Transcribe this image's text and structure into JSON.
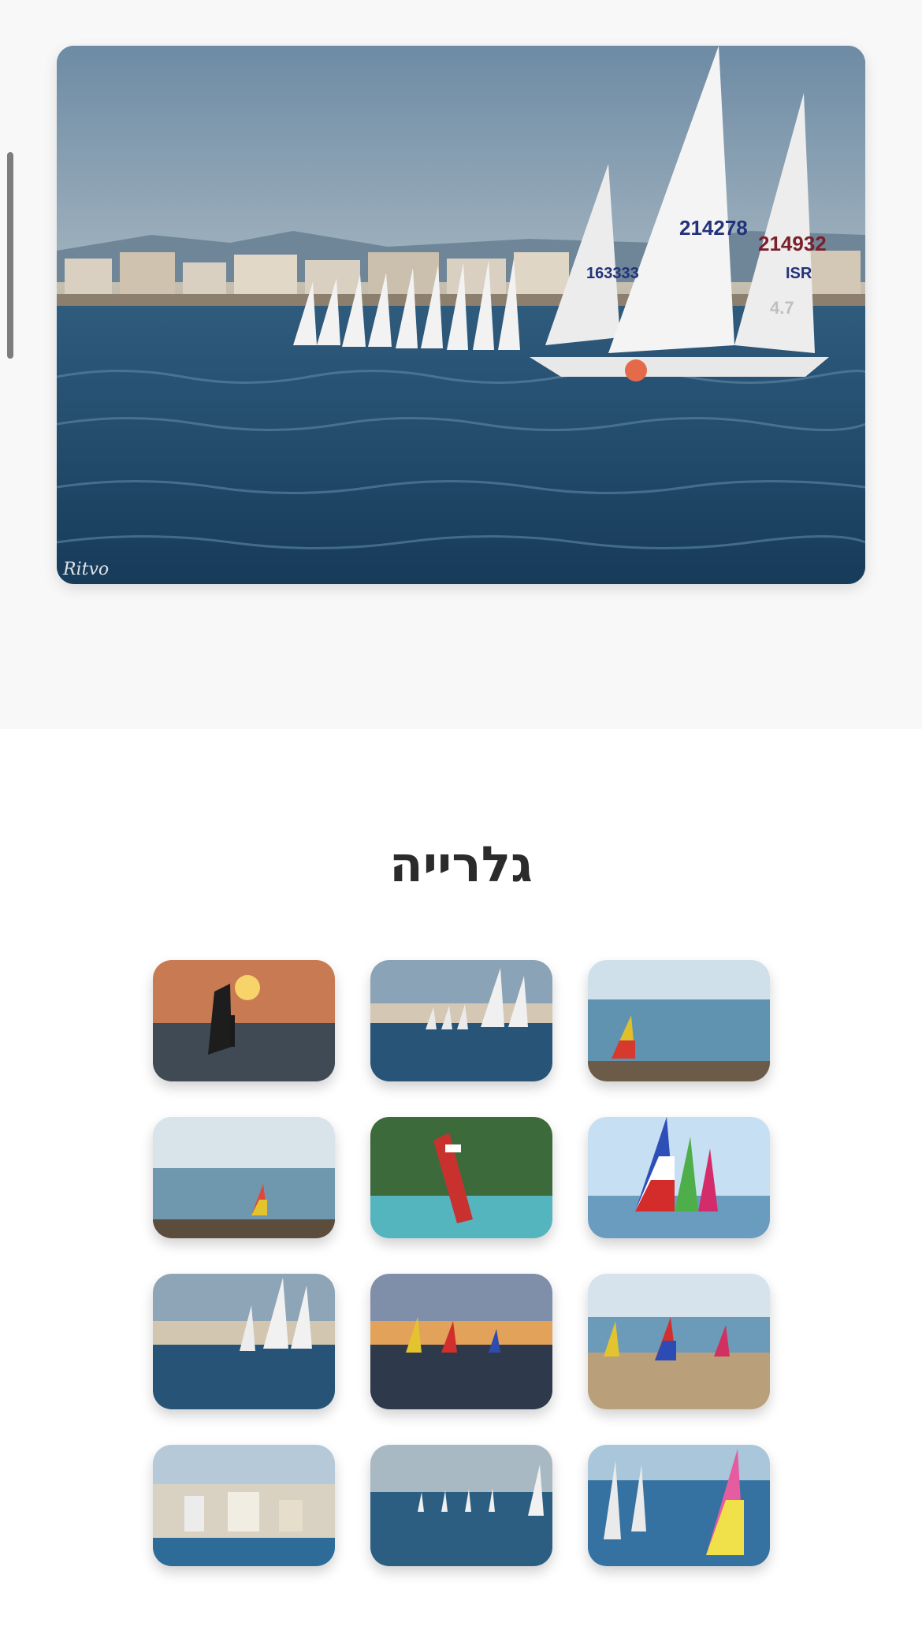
{
  "hero": {
    "image_alt": "Laser sailboats racing off the coast",
    "watermark": "Ritvo",
    "sail_numbers": [
      "163333",
      "214278",
      "214932",
      "ISR",
      "4.7"
    ]
  },
  "gallery": {
    "title": "גלרייה",
    "items": [
      {
        "alt": "Wing foiler at sunset"
      },
      {
        "alt": "Laser fleet off the city"
      },
      {
        "alt": "Optimist sailor on the beach"
      },
      {
        "alt": "Optimist fleet on calm sea"
      },
      {
        "alt": "Windsurfer by forested shore"
      },
      {
        "alt": "Colorful Optimist sails"
      },
      {
        "alt": "Laser fleet racing"
      },
      {
        "alt": "Optimists at sunset"
      },
      {
        "alt": "Optimists launching from beach"
      },
      {
        "alt": "Coastal city from the sea"
      },
      {
        "alt": "Regatta on open water"
      },
      {
        "alt": "Optimist race start"
      }
    ]
  },
  "colors": {
    "hero_background": "#f8f8f8",
    "title_text": "#2b2b2b",
    "page_background": "#ffffff"
  }
}
